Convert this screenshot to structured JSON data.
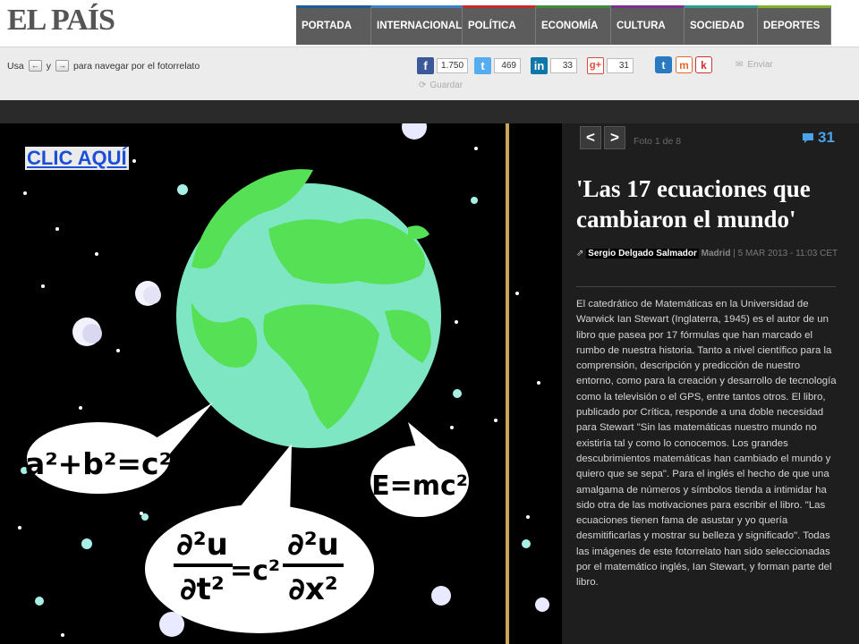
{
  "header": {
    "logo": "EL PAÍS",
    "nav": [
      {
        "label": "PORTADA",
        "accent": "#1c5c99"
      },
      {
        "label": "INTERNACIONAL",
        "accent": "#3a84c4"
      },
      {
        "label": "POLÍTICA",
        "accent": "#c62b2b"
      },
      {
        "label": "ECONOMÍA",
        "accent": "#3b8f3b"
      },
      {
        "label": "CULTURA",
        "accent": "#7c2f8f"
      },
      {
        "label": "SOCIEDAD",
        "accent": "#2f9d8c"
      },
      {
        "label": "DEPORTES",
        "accent": "#84b32b"
      }
    ]
  },
  "share_bar": {
    "hint_prefix": "Usa",
    "hint_and": "y",
    "hint_suffix": "para navegar por el fotorrelato",
    "facebook_count": "1.750",
    "twitter_count": "469",
    "linkedin_count": "33",
    "googleplus_count": "31",
    "enviar_label": "Enviar",
    "guardar_label": "Guardar",
    "colors": {
      "facebook": "#3b5998",
      "twitter": "#55acee",
      "linkedin": "#0e76a8",
      "googleplus": "#dd4b39"
    }
  },
  "photo": {
    "overlay_link": "CLIC AQUÍ",
    "formula_pythagoras": "a²+b²=c²",
    "formula_energy": "E=mc²",
    "formula_wave": "∂²u/∂t² = c² ∂²u/∂x²"
  },
  "panel": {
    "prev_label": "<",
    "next_label": ">",
    "photo_counter": "Foto 1 de 8",
    "comment_count": "31",
    "headline": "'Las 17 ecuaciones que cambiaron el mundo'",
    "author": "Sergio Delgado Salmador",
    "city": "Madrid",
    "date": "5 MAR 2013 - 11:03 CET",
    "body": "El catedrático de Matemáticas en la Universidad de Warwick Ian Stewart (Inglaterra, 1945) es el autor de un libro que pasea por 17 fórmulas que han marcado el rumbo de nuestra historia. Tanto a nivel científico para la comprensión, descripción y predicción de nuestro entorno, como para la creación y desarrollo de tecnología como la televisión o el GPS, entre tantos otros. El libro, publicado por Crítica, responde a una doble necesidad para Stewart \"Sin las matemáticas nuestro mundo no existiría tal y como lo conocemos. Los grandes descubrimientos matemáticas han cambiado el mundo y quiero que se sepa\". Para el inglés el hecho de que una amalgama de números y símbolos tienda a intimidar ha sido otra de las motivaciones para escribir el libro. \"Las ecuaciones tienen fama de asustar y yo quería desmitificarlas y mostrar su belleza y significado\". Todas las imágenes de este fotorrelato han sido seleccionadas por el matemático inglés, Ian Stewart, y forman parte del libro."
  }
}
